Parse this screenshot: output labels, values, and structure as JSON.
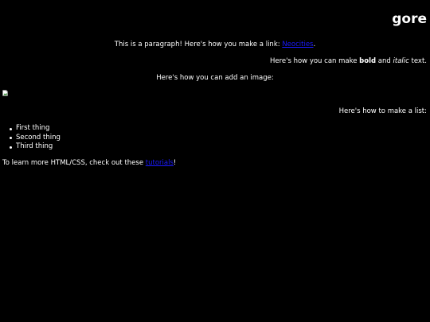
{
  "page": {
    "title": "gore",
    "paragraph": {
      "before": "This is a paragraph! Here's how you make a link: ",
      "link_text": "Neocities",
      "after": "."
    },
    "formatting": {
      "before": "Here's how you can make ",
      "bold": "bold",
      "middle": " and ",
      "italic": "italic",
      "after": " text."
    },
    "image_text": "Here's how you can add an image:",
    "list_intro": "Here's how to make a list:",
    "list_items": [
      "First thing",
      "Second thing",
      "Third thing"
    ],
    "learn_more": {
      "before": "To learn more HTML/CSS, check out these ",
      "link_text": "tutorials",
      "after": "!"
    }
  },
  "colors": {
    "background": "#000000",
    "text": "#ffffff",
    "link": "#1a1aff"
  },
  "icons": {
    "image": "broken-image-icon"
  }
}
